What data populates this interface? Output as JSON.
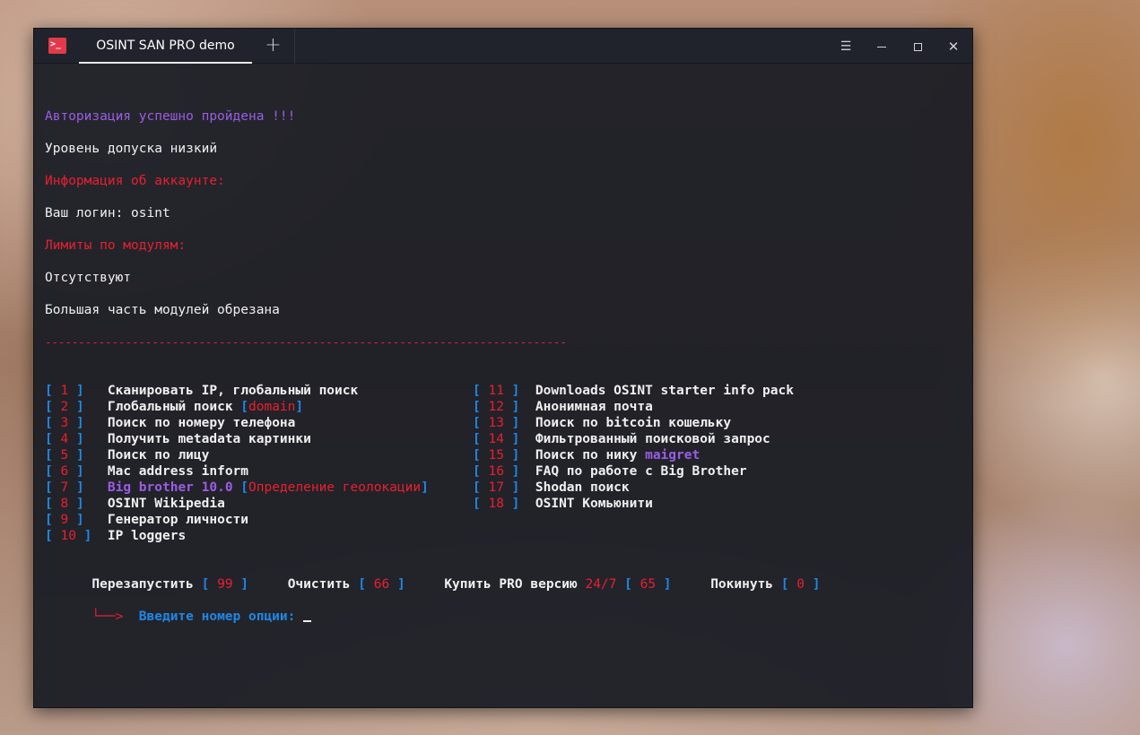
{
  "window": {
    "tab_title": "OSINT SAN PRO demo",
    "new_tab_icon": "plus-icon",
    "menu_icon": "hamburger-icon",
    "minimize_icon": "minimize-icon",
    "maximize_icon": "maximize-icon",
    "close_icon": "close-icon"
  },
  "terminal": {
    "auth_success": "Авторизация успешно пройдена !!!",
    "access_level": "Уровень допуска низкий",
    "account_info_header": "Информация об аккаунте:",
    "login_line": "Ваш логин: osint",
    "limits_header": "Лимиты по модулям:",
    "limits_value": "Отсутствуют",
    "modules_note": "Большая часть модулей обрезана",
    "separator": "------------------------------------------------------------------------------",
    "menu_left": [
      {
        "num": "1",
        "label": "Сканировать IP, глобальный поиск"
      },
      {
        "num": "2",
        "label": "Глобальный поиск ",
        "tag": "domain"
      },
      {
        "num": "3",
        "label": "Поиск по номеру телефона"
      },
      {
        "num": "4",
        "label": "Получить metadata картинки"
      },
      {
        "num": "5",
        "label": "Поиск по лицу"
      },
      {
        "num": "6",
        "label": "Mac address inform"
      },
      {
        "num": "7",
        "label": "Big brother 10.0",
        "tag": "Определение геолокации"
      },
      {
        "num": "8",
        "label": "OSINT Wikipedia"
      },
      {
        "num": "9",
        "label": "Генератор личности"
      },
      {
        "num": "10",
        "label": "IP loggers"
      }
    ],
    "menu_right": [
      {
        "num": "11",
        "label": "Downloads OSINT starter info pack"
      },
      {
        "num": "12",
        "label": "Анонимная почта"
      },
      {
        "num": "13",
        "label": "Поиск по bitcoin кошельку"
      },
      {
        "num": "14",
        "label": "Фильтрованный поисковой запрос"
      },
      {
        "num": "15",
        "label": "Поиск по нику ",
        "tag": "maigret"
      },
      {
        "num": "16",
        "label": "FAQ по работе с Big Brother"
      },
      {
        "num": "17",
        "label": "Shodan поиск"
      },
      {
        "num": "18",
        "label": "OSINT Комьюнити"
      }
    ],
    "actions": {
      "restart_label": "Перезапустить",
      "restart_num": "99",
      "clear_label": "Очистить",
      "clear_num": "66",
      "buy_label": "Купить PRO версию",
      "buy_extra": "24/7",
      "buy_num": "65",
      "exit_label": "Покинуть",
      "exit_num": "0"
    },
    "prompt_arrow": "└──>",
    "prompt_text": "Введите номер опции:"
  }
}
